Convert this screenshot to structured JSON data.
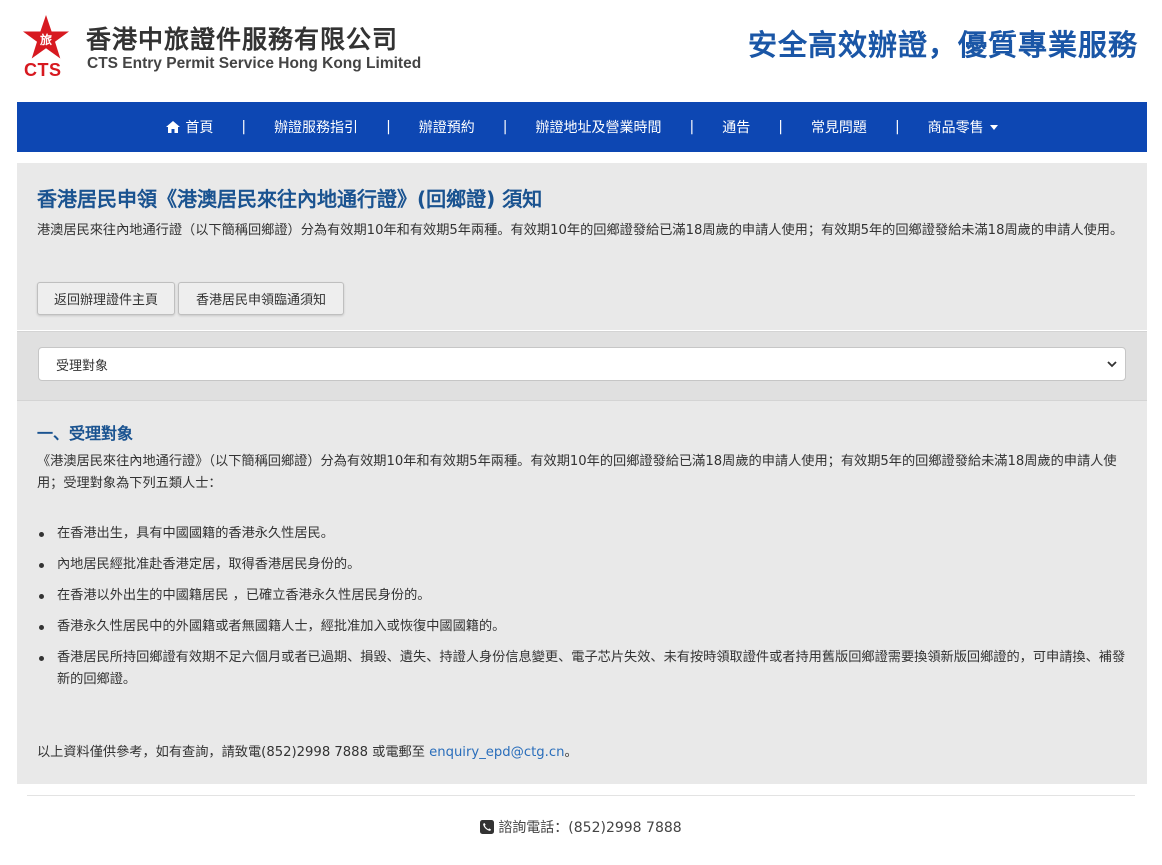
{
  "header": {
    "logo_text": "CTS",
    "company_cn": "香港中旅證件服務有限公司",
    "company_en": "CTS Entry Permit Service Hong Kong Limited",
    "slogan": "安全高效辦證，優質專業服務"
  },
  "nav": {
    "separator": "|",
    "items": [
      {
        "label": "首頁",
        "icon": "home-icon"
      },
      {
        "label": "辦證服務指引"
      },
      {
        "label": "辦證預約"
      },
      {
        "label": "辦證地址及營業時間"
      },
      {
        "label": "通告"
      },
      {
        "label": "常見問題"
      },
      {
        "label": "商品零售",
        "icon": "caret-down-icon"
      }
    ]
  },
  "intro": {
    "title": "香港居民申領《港澳居民來往內地通行證》(回鄉證) 須知",
    "text": "港澳居民來往內地通行證（以下簡稱回鄉證）分為有效期10年和有效期5年兩種。有效期10年的回鄉證發給已滿18周歲的申請人使用；有效期5年的回鄉證發給未滿18周歲的申請人使用。",
    "buttons": {
      "back": "返回辦理證件主頁",
      "notice": "香港居民申領臨通須知"
    }
  },
  "select": {
    "selected": "受理對象"
  },
  "content": {
    "section_title": "一、受理對象",
    "section_text": "《港澳居民來往內地通行證》（以下簡稱回鄉證）分為有效期10年和有效期5年兩種。有效期10年的回鄉證發給已滿18周歲的申請人使用；有效期5年的回鄉證發給未滿18周歲的申請人使用；受理對象為下列五類人士：",
    "bullets": [
      "在香港出生，具有中國國籍的香港永久性居民。",
      "內地居民經批准赴香港定居，取得香港居民身份的。",
      "在香港以外出生的中國籍居民 ，已確立香港永久性居民身份的。",
      "香港永久性居民中的外國籍或者無國籍人士，經批准加入或恢復中國國籍的。",
      "香港居民所持回鄉證有效期不足六個月或者已過期、損毀、遺失、持證人身份信息變更、電子芯片失效、未有按時領取證件或者持用舊版回鄉證需要換領新版回鄉證的，可申請換、補發新的回鄉證。"
    ],
    "note_prefix": "以上資料僅供參考，如有查詢，請致電(852)2998 7888 或電郵至 ",
    "email": "enquiry_epd@ctg.cn",
    "note_suffix": "。"
  },
  "footer": {
    "phone_label": "諮詢電話：(852)2998 7888"
  },
  "colors": {
    "nav_bg": "#0d47b3",
    "title_blue": "#1a5390",
    "slogan_blue": "#1a56a6",
    "logo_red": "#d71920",
    "link": "#2a6ebb"
  }
}
